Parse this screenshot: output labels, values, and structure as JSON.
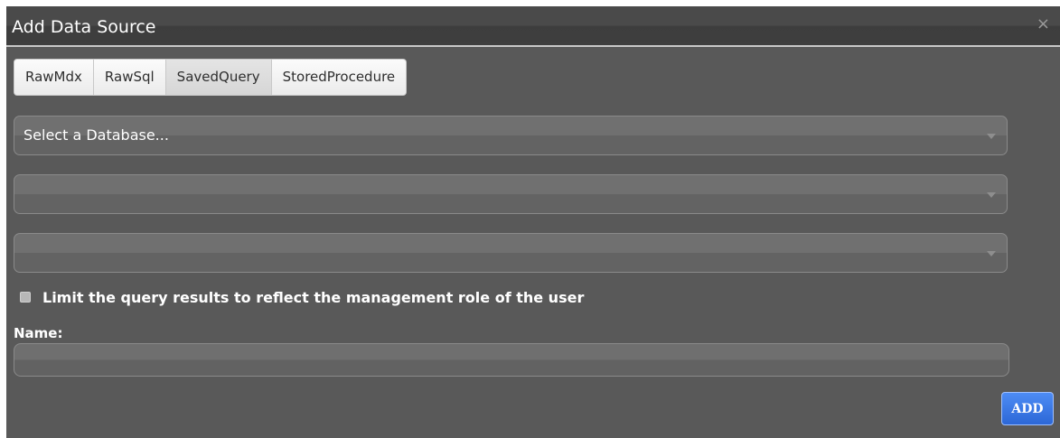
{
  "dialog": {
    "title": "Add Data Source",
    "close_glyph": "×",
    "tabs": [
      {
        "label": "RawMdx"
      },
      {
        "label": "RawSql"
      },
      {
        "label": "SavedQuery"
      },
      {
        "label": "StoredProcedure"
      }
    ],
    "database_select": {
      "placeholder": "Select a Database..."
    },
    "select_2": {
      "value": ""
    },
    "select_3": {
      "value": ""
    },
    "limit_checkbox": {
      "label": "Limit the query results to reflect the management role of the user",
      "checked": false
    },
    "name_field": {
      "label": "Name:",
      "value": ""
    },
    "add_button": {
      "label": "ADD"
    }
  },
  "colors": {
    "dialog_bg": "#595959",
    "add_button": "#3a7be6"
  }
}
